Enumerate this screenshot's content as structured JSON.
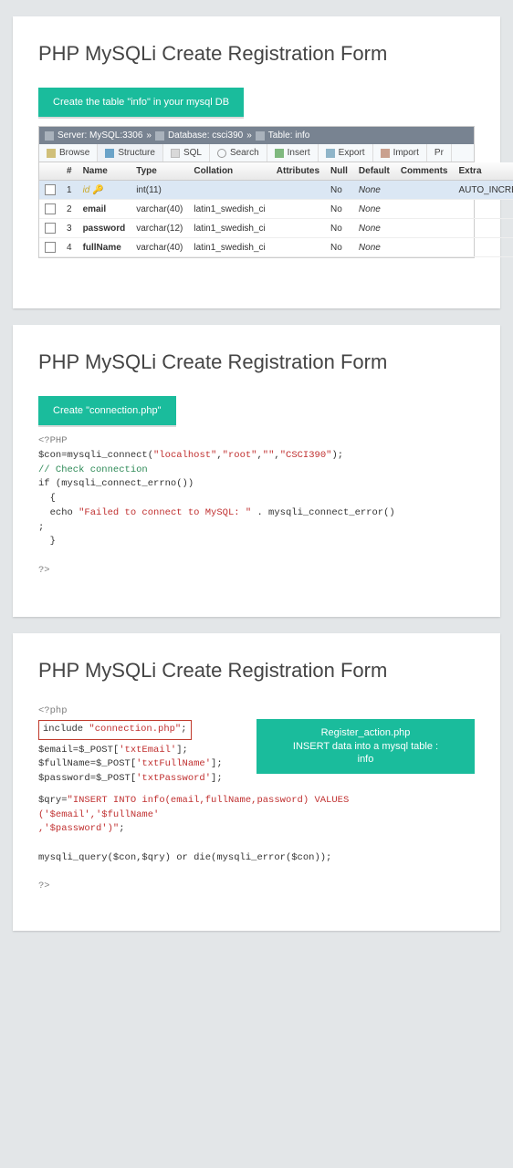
{
  "title": "PHP MySQLi Create Registration Form",
  "slide1": {
    "step_label": "Create the table \"info\" in your mysql DB",
    "crumb": {
      "server": "Server: MySQL:3306",
      "database": "Database: csci390",
      "table": "Table: info"
    },
    "tabs": {
      "browse": "Browse",
      "structure": "Structure",
      "sql": "SQL",
      "search": "Search",
      "insert": "Insert",
      "export": "Export",
      "import": "Import",
      "more": "Pr"
    },
    "headers": {
      "num": "#",
      "name": "Name",
      "type": "Type",
      "collation": "Collation",
      "attributes": "Attributes",
      "null": "Null",
      "default": "Default",
      "comments": "Comments",
      "extra": "Extra"
    },
    "rows": [
      {
        "num": "1",
        "name": "id",
        "type": "int(11)",
        "collation": "",
        "null": "No",
        "default": "None",
        "extra": "AUTO_INCREMENT",
        "pk": true,
        "sel": true
      },
      {
        "num": "2",
        "name": "email",
        "type": "varchar(40)",
        "collation": "latin1_swedish_ci",
        "null": "No",
        "default": "None",
        "extra": ""
      },
      {
        "num": "3",
        "name": "password",
        "type": "varchar(12)",
        "collation": "latin1_swedish_ci",
        "null": "No",
        "default": "None",
        "extra": ""
      },
      {
        "num": "4",
        "name": "fullName",
        "type": "varchar(40)",
        "collation": "latin1_swedish_ci",
        "null": "No",
        "default": "None",
        "extra": ""
      }
    ]
  },
  "slide2": {
    "step_label": "Create \"connection.php\"",
    "code_html": "<span class=\"php-tag\">&lt;?PHP</span>\n$con=<span class=\"func\">mysqli_connect</span>(<span class=\"str\">\"localhost\"</span>,<span class=\"str\">\"root\"</span>,<span class=\"str\">\"\"</span>,<span class=\"str\">\"CSCI390\"</span>);\n<span class=\"cmt\">// Check connection</span>\nif (mysqli_connect_errno())\n  {\n  echo <span class=\"str\">\"Failed to connect to MySQL: \"</span> . mysqli_connect_error()\n;\n  }\n\n<span class=\"php-tag\">?&gt;</span>"
  },
  "slide3": {
    "note_title": "Register_action.php",
    "note_sub1": "INSERT data into a mysql table :",
    "note_sub2": "info",
    "code_top_html": "<span class=\"php-tag\">&lt;?php</span>",
    "include_html": "<span class=\"func\">include</span> <span class=\"str\">\"connection.php\"</span>;",
    "code_mid_html": "$email=$_POST[<span class=\"str\">'txtEmail'</span>];\n$fullName=$_POST[<span class=\"str\">'txtFullName'</span>];\n$password=$_POST[<span class=\"str\">'txtPassword'</span>];",
    "code_bottom_html": "$qry=<span class=\"str\">\"INSERT INTO info(email,fullName,password) VALUES ('$email','$fullName'\n,'$password')\"</span>;\n\nmysqli_query($con,$qry) or die(mysqli_error($con));\n\n<span class=\"php-tag\">?&gt;</span>"
  }
}
